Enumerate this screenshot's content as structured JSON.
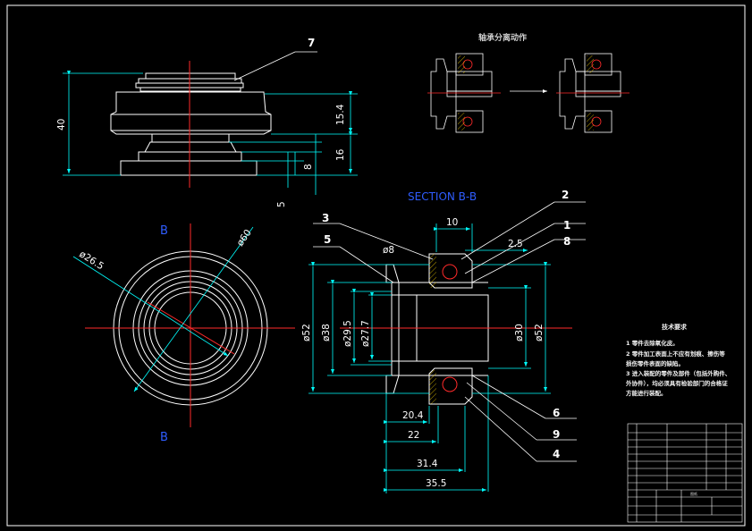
{
  "colors": {
    "background": "#000000",
    "outline": "#ffffff",
    "centerline": "#ff2a2a",
    "dimension": "#00ffff",
    "section_label": "#2f5dff",
    "hatch": "#ffd700"
  },
  "side_view": {
    "part_label": "7",
    "dim_height": "40",
    "dim_15_4": "15.4",
    "dim_16": "16",
    "dim_8": "8",
    "dim_5": "5"
  },
  "front_view": {
    "section_mark_top": "B",
    "section_mark_bottom": "B",
    "dia_outer": "ø60",
    "dia_inner": "ø26.5"
  },
  "section_view": {
    "title": "SECTION B-B",
    "dim_top": "10",
    "dim_gap": "2.5",
    "dim_ball": "ø8",
    "dia_52_left": "ø52",
    "dia_38": "ø38",
    "dia_29_5": "ø29.5",
    "dia_27_7": "ø27.7",
    "dia_30": "ø30",
    "dia_52_right": "ø52",
    "len_20_4": "20.4",
    "len_22": "22",
    "len_31_4": "31.4",
    "len_35_5": "35.5",
    "callouts": [
      "2",
      "1",
      "8",
      "3",
      "5",
      "6",
      "9",
      "4"
    ]
  },
  "detail_view": {
    "title": "轴承分离动作"
  },
  "notes": {
    "heading": "技术要求",
    "lines": [
      "1 零件去除氧化皮。",
      "2 零件加工表面上不应有划痕、擦伤等",
      "损伤零件表面的缺陷。",
      "3 进入装配的零件及部件（包括外购件、",
      "外协件），均必须具有检验部门的合格证",
      "方能进行装配。"
    ]
  },
  "title_block": {
    "block_title": "图纸"
  }
}
